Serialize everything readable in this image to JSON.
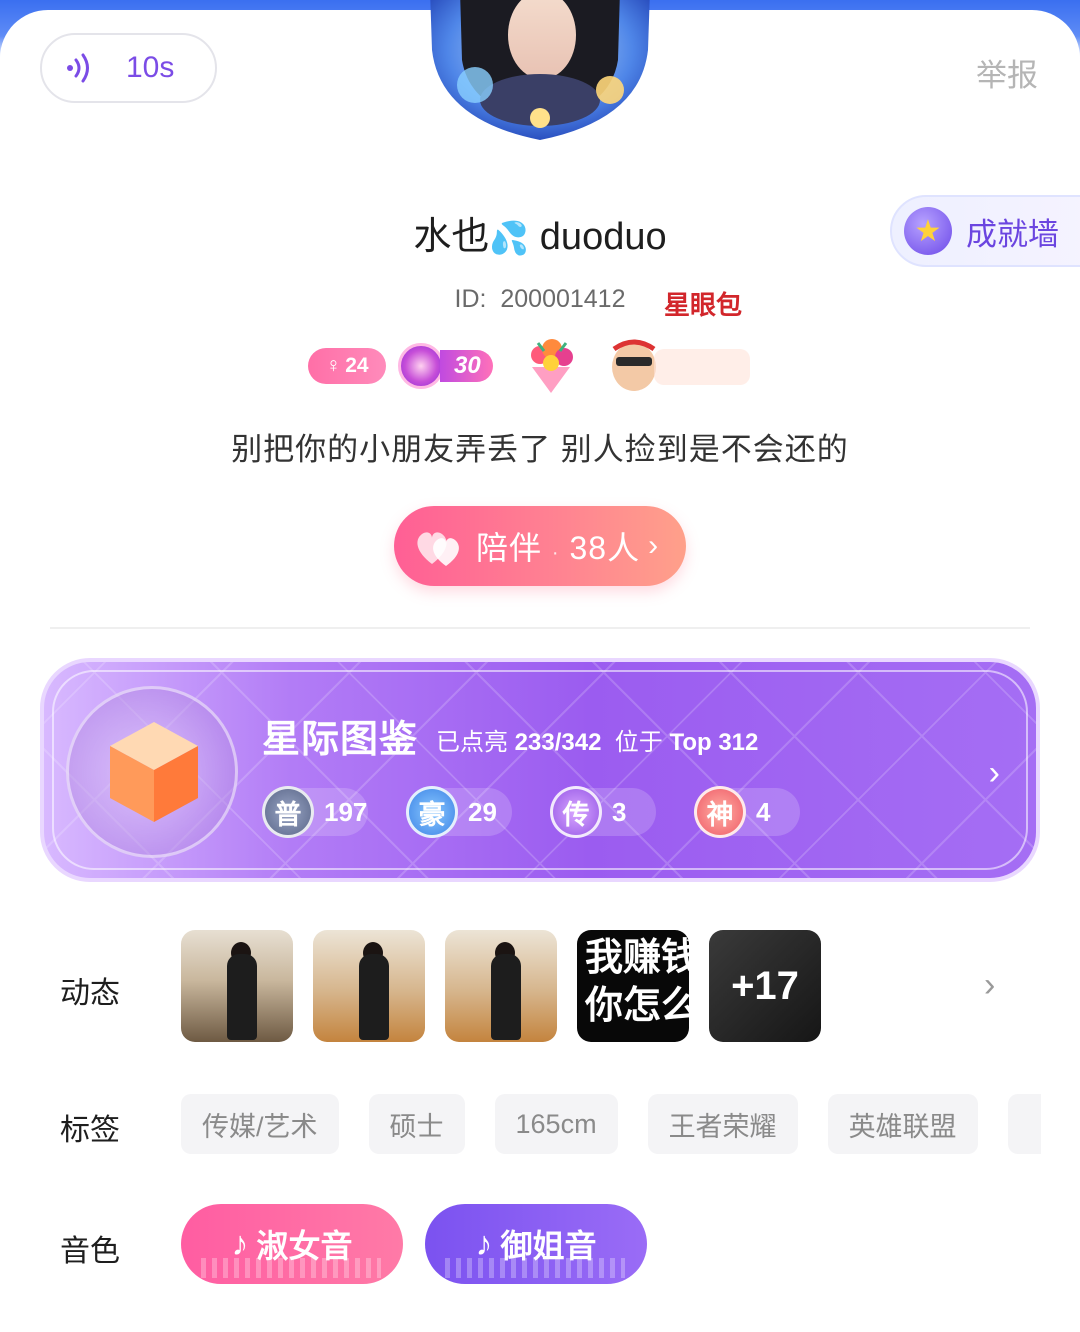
{
  "voice": {
    "duration": "10s"
  },
  "header": {
    "report_label": "举报"
  },
  "profile": {
    "name_prefix": "水也",
    "name_emoji": "💦",
    "name_suffix": "duoduo",
    "id_label": "ID:",
    "id_value": "200001412",
    "gender_age": "24",
    "level": "30",
    "sticker_text": "星眼包",
    "bio": "别把你的小朋友弄丢了 别人捡到是不会还的"
  },
  "achievement_wall": {
    "label": "成就墙"
  },
  "companion": {
    "label": "陪伴",
    "separator": "·",
    "count": "38人",
    "arrow": "›"
  },
  "atlas": {
    "title": "星际图鉴",
    "lit_prefix": "已点亮",
    "lit_value": "233/342",
    "rank_prefix": "位于",
    "rank_value": "Top 312",
    "rarities": [
      {
        "char": "普",
        "count": "197"
      },
      {
        "char": "豪",
        "count": "29"
      },
      {
        "char": "传",
        "count": "3"
      },
      {
        "char": "神",
        "count": "4"
      }
    ]
  },
  "moments": {
    "label": "动态",
    "text_card": "我赚钱\n你怎么",
    "more": "+17"
  },
  "tags": {
    "label": "标签",
    "items": [
      "传媒/艺术",
      "硕士",
      "165cm",
      "王者荣耀",
      "英雄联盟"
    ]
  },
  "voice_types": {
    "label": "音色",
    "items": [
      "淑女音",
      "御姐音"
    ],
    "note_symbol": "♪"
  },
  "colors": {
    "accent_purple": "#7b4ce6",
    "companion_pink": "#ff5f95",
    "atlas_purple": "#9b5cf0"
  }
}
